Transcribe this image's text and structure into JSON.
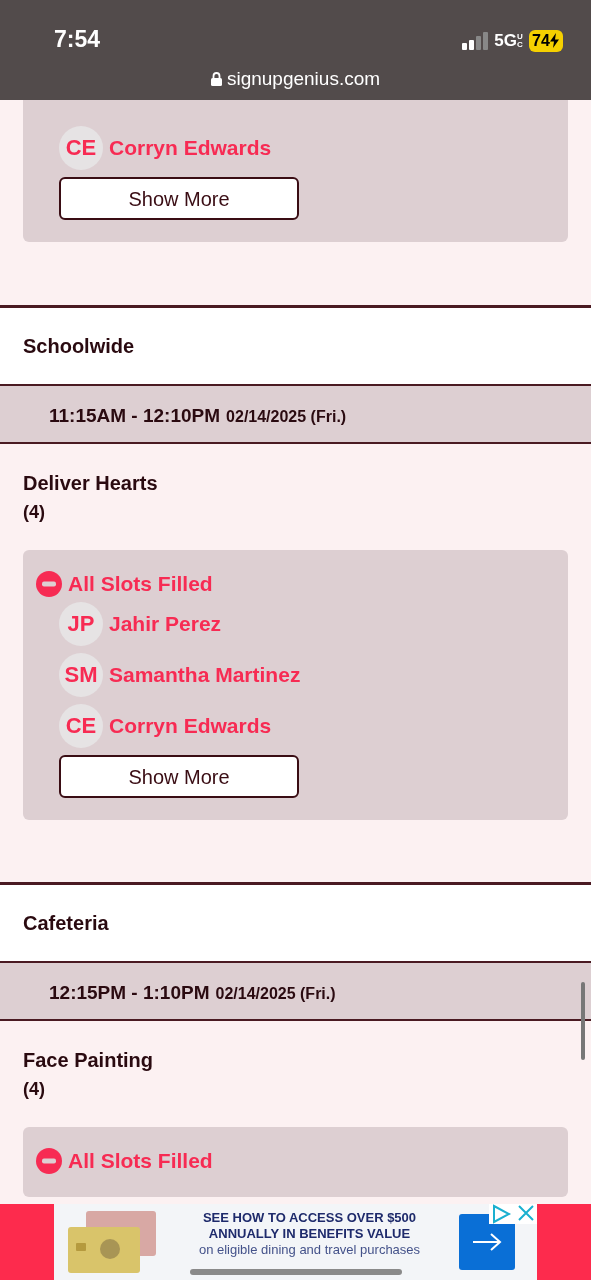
{
  "status_bar": {
    "time": "7:54",
    "network": "5G",
    "network_sub": "UC",
    "battery": "74",
    "charging": true
  },
  "address_bar": {
    "url": "signupgenius.com"
  },
  "top_card": {
    "participants": [
      {
        "initials": "CE",
        "name": "Corryn Edwards"
      }
    ],
    "button": "Show More"
  },
  "sections": [
    {
      "title": "Schoolwide",
      "time": "11:15AM - 12:10PM",
      "date": "02/14/2025 (Fri.)",
      "task": "Deliver Hearts",
      "count": "(4)",
      "status": "All Slots Filled",
      "participants": [
        {
          "initials": "JP",
          "name": "Jahir Perez"
        },
        {
          "initials": "SM",
          "name": "Samantha Martinez"
        },
        {
          "initials": "CE",
          "name": "Corryn Edwards"
        }
      ],
      "button": "Show More"
    },
    {
      "title": "Cafeteria",
      "time": "12:15PM - 1:10PM",
      "date": "02/14/2025 (Fri.)",
      "task": "Face Painting",
      "count": "(4)",
      "status": "All Slots Filled"
    }
  ],
  "ad": {
    "headline": [
      "SEE HOW TO ACCESS OVER $500",
      "ANNUALLY IN BENEFITS VALUE"
    ],
    "subline": "on eligible dining and travel purchases"
  }
}
